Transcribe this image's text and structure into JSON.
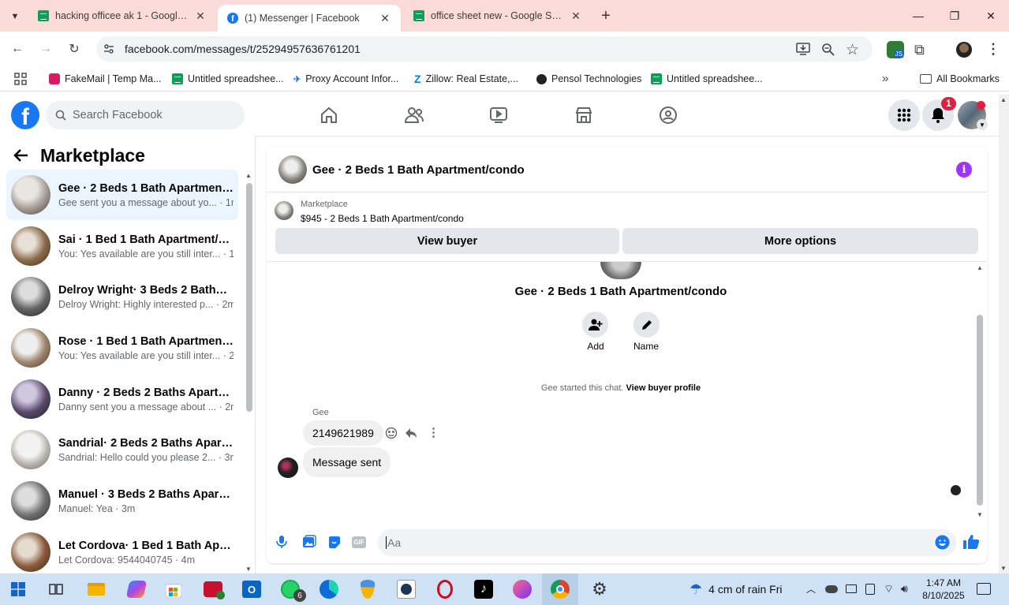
{
  "browser": {
    "tabs": [
      {
        "title": "hacking officee ak 1 - Google Sl",
        "icon": "sheets-icon",
        "active": false
      },
      {
        "title": "(1) Messenger | Facebook",
        "icon": "facebook-icon",
        "active": true
      },
      {
        "title": "office sheet new - Google Sheet",
        "icon": "sheets-icon",
        "active": false
      }
    ],
    "url": "facebook.com/messages/t/25294957636761201",
    "bookmarks": [
      {
        "label": "FakeMail | Temp Ma..."
      },
      {
        "label": "Untitled spreadshee..."
      },
      {
        "label": "Proxy Account Infor..."
      },
      {
        "label": "Zillow: Real Estate,..."
      },
      {
        "label": "Pensol Technologies"
      },
      {
        "label": "Untitled spreadshee..."
      }
    ],
    "all_bookmarks": "All Bookmarks",
    "extension_badge": "JS"
  },
  "facebook": {
    "search_placeholder": "Search Facebook",
    "notification_count": "1",
    "back_title": "Marketplace",
    "conversations": [
      {
        "title": "Gee · 2 Beds 1 Bath Apartment/...",
        "preview": "Gee sent you a message about yo... · 1m",
        "selected": true
      },
      {
        "title": "Sai · 1 Bed 1 Bath Apartment/co...",
        "preview": "You: Yes available are you still inter... · 1m",
        "selected": false
      },
      {
        "title": "Delroy Wright· 3 Beds 2 Baths A...",
        "preview": "Delroy Wright: Highly interested p... · 2m",
        "selected": false
      },
      {
        "title": "Rose · 1 Bed 1 Bath Apartment/c...",
        "preview": "You: Yes available are you still inter... · 2m",
        "selected": false
      },
      {
        "title": "Danny · 2 Beds 2 Baths Apartme...",
        "preview": "Danny sent you a message about ... · 2m",
        "selected": false
      },
      {
        "title": "Sandrial· 2 Beds 2 Baths Apartm...",
        "preview": "Sandrial: Hello could you please 2... · 3m",
        "selected": false
      },
      {
        "title": "Manuel · 3 Beds 2 Baths Apartm...",
        "preview": "Manuel: Yea · 3m",
        "selected": false
      },
      {
        "title": "Let Cordova· 1 Bed 1 Bath Apart...",
        "preview": "Let Cordova: 9544040745 · 4m",
        "selected": false
      }
    ],
    "chat": {
      "header_title": "Gee · 2 Beds 1 Bath Apartment/condo",
      "marketplace_label": "Marketplace",
      "listing": "$945 - 2 Beds 1 Bath Apartment/condo",
      "view_buyer": "View buyer",
      "more_options": "More options",
      "profile_name": "Gee · 2 Beds 1 Bath Apartment/condo",
      "add_label": "Add",
      "name_label": "Name",
      "started_text": "Gee started this chat.",
      "view_profile": "View buyer profile",
      "sender": "Gee",
      "messages": [
        {
          "text": "2149621989",
          "from": "them"
        },
        {
          "text": "Message sent",
          "from": "them"
        }
      ],
      "composer_placeholder": "Aa"
    }
  },
  "taskbar": {
    "weather": "4 cm of rain Fri",
    "time": "1:47 AM",
    "date": "8/10/2025",
    "whatsapp_badge": "6"
  },
  "colors": {
    "fb_blue": "#1877f2",
    "tabbar": "#fadbd8",
    "taskbar": "#cfe1f4",
    "selected_conv": "#ebf5ff",
    "notif_red": "#e41e3f"
  }
}
